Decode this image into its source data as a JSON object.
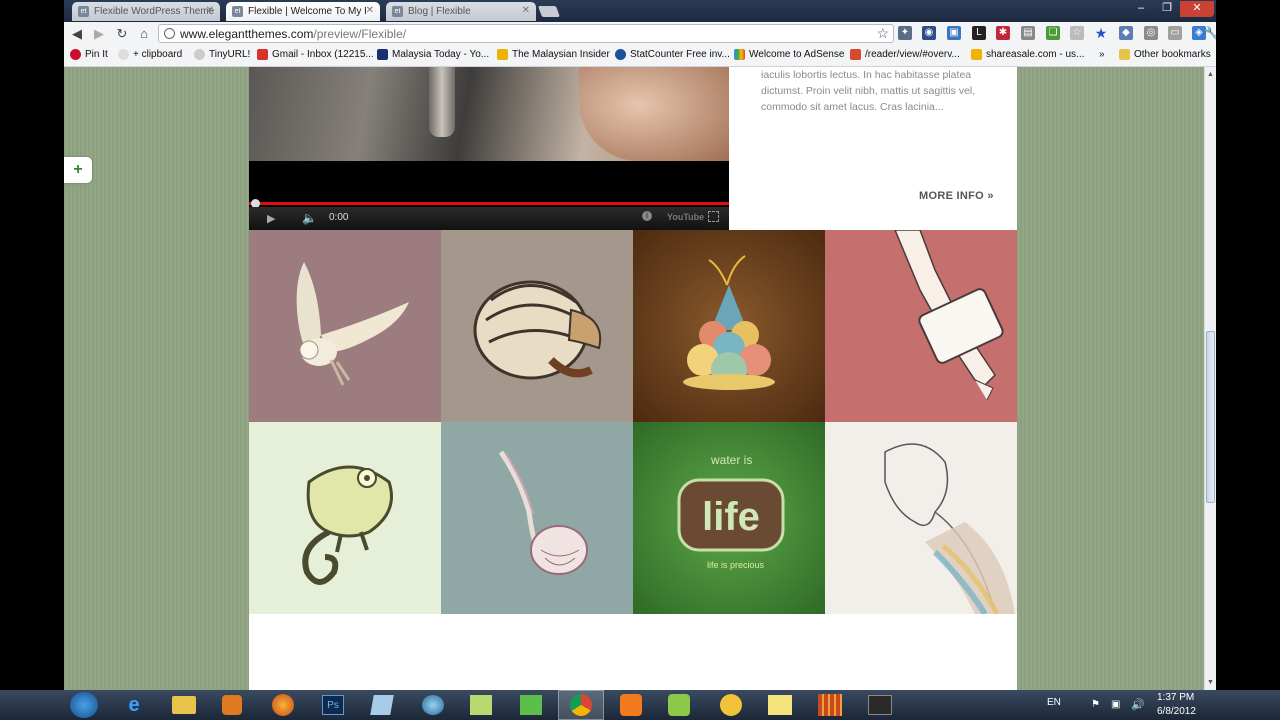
{
  "browser": {
    "tabs": [
      {
        "label": "Flexible WordPress Theme",
        "favicon": "et"
      },
      {
        "label": "Flexible | Welcome To My P",
        "favicon": "et",
        "active": true
      },
      {
        "label": "Blog | Flexible",
        "favicon": "et"
      }
    ],
    "url_domain": "www.elegantthemes.com",
    "url_path": "/preview/Flexible/",
    "bookmarks": [
      {
        "label": "Pin It",
        "icon": "pin-icon"
      },
      {
        "label": "+ clipboard",
        "icon": "clipboard-icon"
      },
      {
        "label": "TinyURL!",
        "icon": "tinyurl-icon"
      },
      {
        "label": "Gmail - Inbox (12215...",
        "icon": "gmail-icon"
      },
      {
        "label": "Malaysia Today - Yo...",
        "icon": "mt-icon"
      },
      {
        "label": "The Malaysian Insider",
        "icon": "tmi-icon"
      },
      {
        "label": "StatCounter Free inv...",
        "icon": "statcounter-icon"
      },
      {
        "label": "Welcome to AdSense",
        "icon": "adsense-icon"
      },
      {
        "label": "/reader/view/#overv...",
        "icon": "reader-icon"
      },
      {
        "label": "shareasale.com - us...",
        "icon": "shareasale-icon"
      },
      {
        "label": "»",
        "icon": ""
      },
      {
        "label": "Other bookmarks",
        "icon": "folder-icon"
      }
    ]
  },
  "page": {
    "description": "iaculis lobortis lectus. In hac habitasse platea dictumst. Proin velit nibh, mattis ut sagittis vel, commodo sit amet lacus. Cras lacinia...",
    "more_info": "MORE INFO »",
    "video_time": "0:00",
    "video_logo": "YouTube",
    "gallery": [
      {
        "name": "owl",
        "bg": "#9c7c7f"
      },
      {
        "name": "armadillo",
        "bg": "#a4978b"
      },
      {
        "name": "snail-tree",
        "bg": "#6a3f1e"
      },
      {
        "name": "figure-with-bag",
        "bg": "#c5706f"
      },
      {
        "name": "chameleon",
        "bg": "#e6efd8"
      },
      {
        "name": "jellyfish",
        "bg": "#8fa8a6"
      },
      {
        "name": "water-is-life",
        "bg": "#4d8a3a",
        "text": "water is life"
      },
      {
        "name": "woman-sketch",
        "bg": "#f2efea"
      }
    ]
  },
  "taskbar": {
    "language": "EN",
    "time": "1:37 PM",
    "date": "6/8/2012"
  }
}
